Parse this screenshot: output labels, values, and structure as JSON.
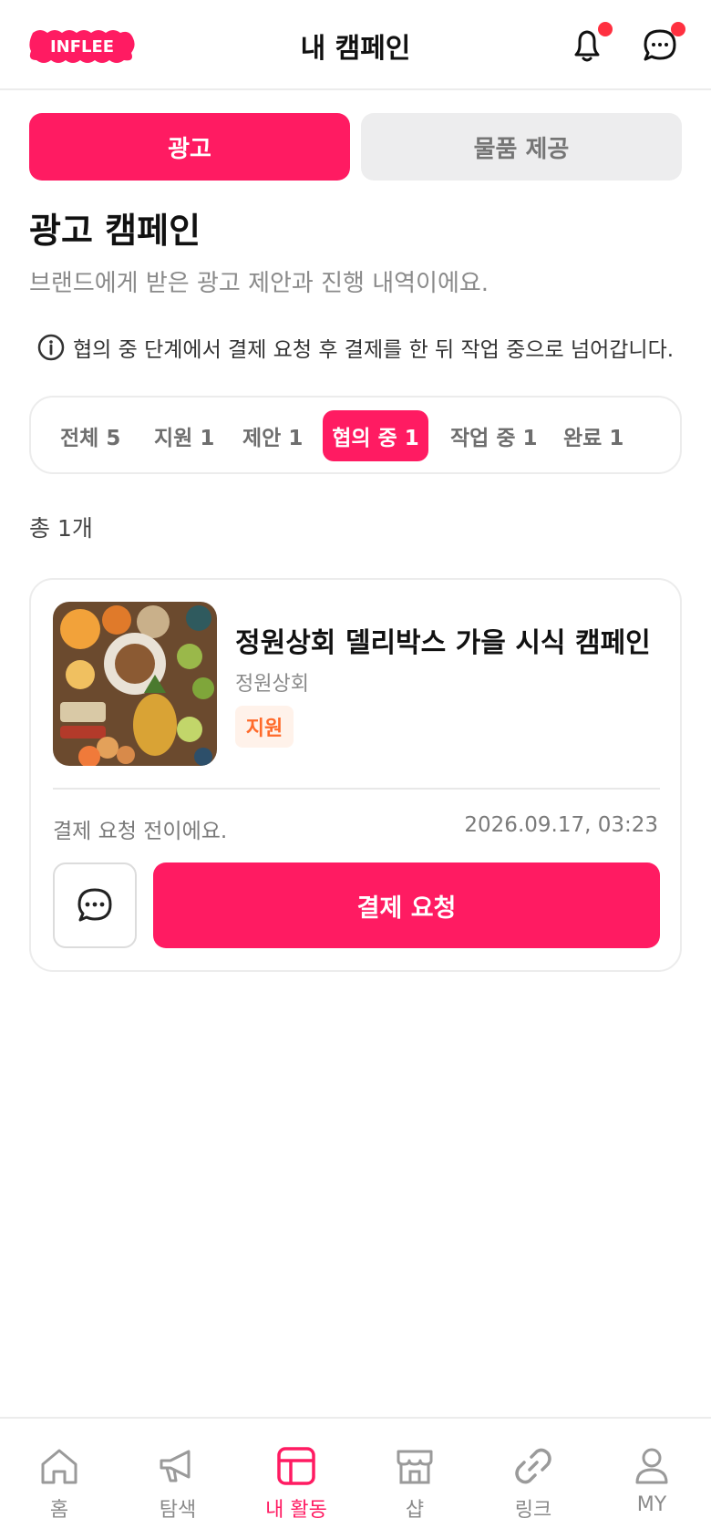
{
  "header": {
    "logo_text": "INFLEE",
    "title": "내 캠페인",
    "bell_icon": "bell-icon",
    "chat_icon": "chat-icon",
    "badge_color": "#ff3040"
  },
  "segments": {
    "ad": "광고",
    "product": "물품 제공",
    "selected": "ad"
  },
  "section": {
    "title": "광고 캠페인",
    "subtitle": "브랜드에게 받은 광고 제안과 진행 내역이에요.",
    "info": "협의 중 단계에서 결제 요청 후 결제를 한 뒤 작업 중으로 넘어갑니다."
  },
  "filters": [
    {
      "label": "전체 5",
      "active": false
    },
    {
      "label": "지원 1",
      "active": false
    },
    {
      "label": "제안 1",
      "active": false
    },
    {
      "label": "협의 중 1",
      "active": true
    },
    {
      "label": "작업 중 1",
      "active": false
    },
    {
      "label": "완료 1",
      "active": false
    }
  ],
  "total": "총 1개",
  "campaign": {
    "title": "정원상회 델리박스 가을 시식 캠페인",
    "brand": "정원상회",
    "badge": "지원",
    "status": "결제 요청 전이에요.",
    "datetime": "2026.09.17, 03:23",
    "cta": "결제 요청"
  },
  "nav": [
    {
      "label": "홈",
      "icon": "home-icon",
      "active": false
    },
    {
      "label": "탐색",
      "icon": "megaphone-icon",
      "active": false
    },
    {
      "label": "내 활동",
      "icon": "layout-icon",
      "active": true
    },
    {
      "label": "샵",
      "icon": "store-icon",
      "active": false
    },
    {
      "label": "링크",
      "icon": "link-icon",
      "active": false
    },
    {
      "label": "MY",
      "icon": "user-icon",
      "active": false
    }
  ],
  "colors": {
    "accent": "#ff1b62",
    "badge_text": "#ff6a2a",
    "badge_bg": "#fff2ea"
  }
}
